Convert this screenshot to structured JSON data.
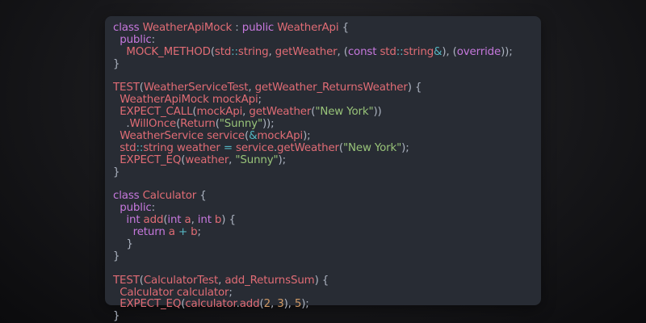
{
  "editor": {
    "lines": [
      [
        [
          "kw",
          "class "
        ],
        [
          "ty",
          "WeatherApiMock"
        ],
        [
          "pu",
          " : "
        ],
        [
          "kw",
          "public "
        ],
        [
          "ty",
          "WeatherApi"
        ],
        [
          "pu",
          " {"
        ]
      ],
      [
        [
          "kw",
          "  public"
        ],
        [
          "pu",
          ":"
        ]
      ],
      [
        [
          "fn",
          "    MOCK_METHOD"
        ],
        [
          "pu",
          "("
        ],
        [
          "ty",
          "std"
        ],
        [
          "op",
          "::"
        ],
        [
          "ty",
          "string"
        ],
        [
          "pu",
          ", "
        ],
        [
          "fn",
          "getWeather"
        ],
        [
          "pu",
          ", ("
        ],
        [
          "kw",
          "const "
        ],
        [
          "ty",
          "std"
        ],
        [
          "op",
          "::"
        ],
        [
          "ty",
          "string"
        ],
        [
          "op",
          "&"
        ],
        [
          "pu",
          "), ("
        ],
        [
          "kw",
          "override"
        ],
        [
          "pu",
          "));"
        ]
      ],
      [
        [
          "pu",
          "}"
        ]
      ],
      [
        [
          "pl",
          ""
        ]
      ],
      [
        [
          "fn",
          "TEST"
        ],
        [
          "pu",
          "("
        ],
        [
          "ty",
          "WeatherServiceTest"
        ],
        [
          "pu",
          ", "
        ],
        [
          "fn",
          "getWeather_ReturnsWeather"
        ],
        [
          "pu",
          ") {"
        ]
      ],
      [
        [
          "ty",
          "  WeatherApiMock "
        ],
        [
          "fn",
          "mockApi"
        ],
        [
          "pu",
          ";"
        ]
      ],
      [
        [
          "fn",
          "  EXPECT_CALL"
        ],
        [
          "pu",
          "("
        ],
        [
          "fn",
          "mockApi"
        ],
        [
          "pu",
          ", "
        ],
        [
          "fn",
          "getWeather"
        ],
        [
          "pu",
          "("
        ],
        [
          "str",
          "\"New York\""
        ],
        [
          "pu",
          "))"
        ]
      ],
      [
        [
          "pu",
          "    ."
        ],
        [
          "fn",
          "WillOnce"
        ],
        [
          "pu",
          "("
        ],
        [
          "fn",
          "Return"
        ],
        [
          "pu",
          "("
        ],
        [
          "str",
          "\"Sunny\""
        ],
        [
          "pu",
          "));"
        ]
      ],
      [
        [
          "ty",
          "  WeatherService "
        ],
        [
          "fn",
          "service"
        ],
        [
          "pu",
          "("
        ],
        [
          "op",
          "&"
        ],
        [
          "fn",
          "mockApi"
        ],
        [
          "pu",
          ");"
        ]
      ],
      [
        [
          "ty",
          "  std"
        ],
        [
          "op",
          "::"
        ],
        [
          "ty",
          "string "
        ],
        [
          "fn",
          "weather"
        ],
        [
          "op",
          " = "
        ],
        [
          "fn",
          "service"
        ],
        [
          "pu",
          "."
        ],
        [
          "fn",
          "getWeather"
        ],
        [
          "pu",
          "("
        ],
        [
          "str",
          "\"New York\""
        ],
        [
          "pu",
          ");"
        ]
      ],
      [
        [
          "fn",
          "  EXPECT_EQ"
        ],
        [
          "pu",
          "("
        ],
        [
          "fn",
          "weather"
        ],
        [
          "pu",
          ", "
        ],
        [
          "str",
          "\"Sunny\""
        ],
        [
          "pu",
          ");"
        ]
      ],
      [
        [
          "pu",
          "}"
        ]
      ],
      [
        [
          "pl",
          ""
        ]
      ],
      [
        [
          "kw",
          "class "
        ],
        [
          "ty",
          "Calculator"
        ],
        [
          "pu",
          " {"
        ]
      ],
      [
        [
          "kw",
          "  public"
        ],
        [
          "pu",
          ":"
        ]
      ],
      [
        [
          "kw",
          "    int "
        ],
        [
          "fn",
          "add"
        ],
        [
          "pu",
          "("
        ],
        [
          "kw",
          "int "
        ],
        [
          "fn",
          "a"
        ],
        [
          "pu",
          ", "
        ],
        [
          "kw",
          "int "
        ],
        [
          "fn",
          "b"
        ],
        [
          "pu",
          ") {"
        ]
      ],
      [
        [
          "kw",
          "      return "
        ],
        [
          "fn",
          "a"
        ],
        [
          "op",
          " + "
        ],
        [
          "fn",
          "b"
        ],
        [
          "pu",
          ";"
        ]
      ],
      [
        [
          "pu",
          "    }"
        ]
      ],
      [
        [
          "pu",
          "}"
        ]
      ],
      [
        [
          "pl",
          ""
        ]
      ],
      [
        [
          "fn",
          "TEST"
        ],
        [
          "pu",
          "("
        ],
        [
          "ty",
          "CalculatorTest"
        ],
        [
          "pu",
          ", "
        ],
        [
          "fn",
          "add_ReturnsSum"
        ],
        [
          "pu",
          ") {"
        ]
      ],
      [
        [
          "ty",
          "  Calculator "
        ],
        [
          "fn",
          "calculator"
        ],
        [
          "pu",
          ";"
        ]
      ],
      [
        [
          "fn",
          "  EXPECT_EQ"
        ],
        [
          "pu",
          "("
        ],
        [
          "fn",
          "calculator"
        ],
        [
          "pu",
          "."
        ],
        [
          "fn",
          "add"
        ],
        [
          "pu",
          "("
        ],
        [
          "num",
          "2"
        ],
        [
          "pu",
          ", "
        ],
        [
          "num",
          "3"
        ],
        [
          "pu",
          "), "
        ],
        [
          "num",
          "5"
        ],
        [
          "pu",
          ");"
        ]
      ],
      [
        [
          "pu",
          "}"
        ]
      ]
    ]
  }
}
